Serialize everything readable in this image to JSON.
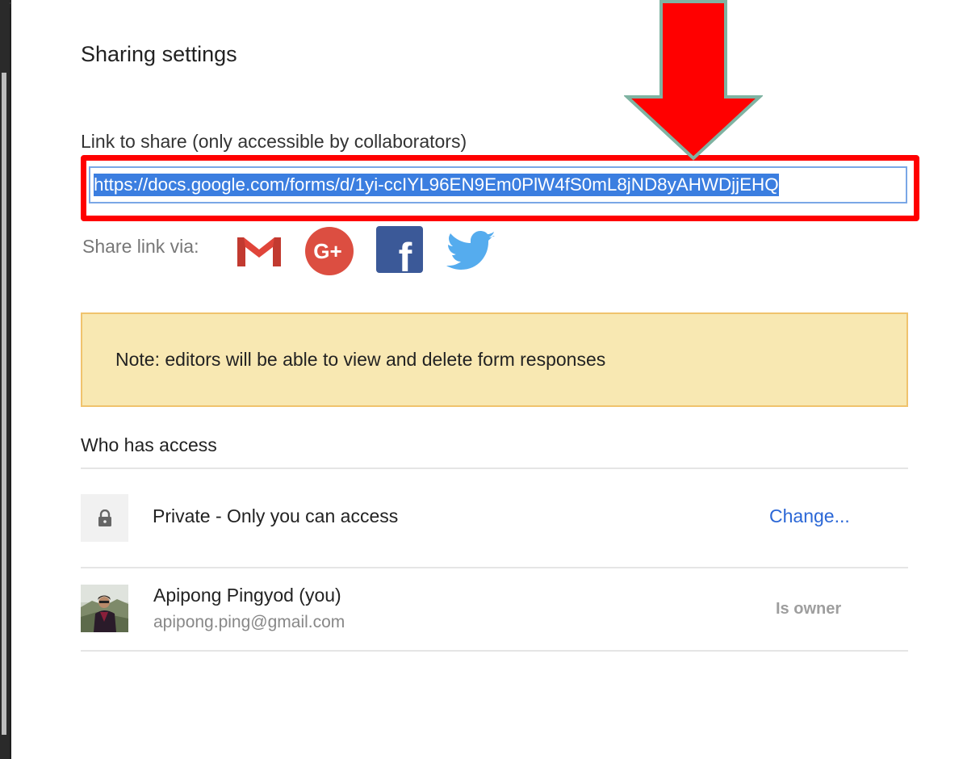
{
  "dialog": {
    "title": "Sharing settings"
  },
  "link": {
    "label": "Link to share (only accessible by collaborators)",
    "url": "https://docs.google.com/forms/d/1yi-ccIYL96EN9Em0PlW4fS0mL8jND8yAHWDjjEHQ"
  },
  "share_via": {
    "label": "Share link via:",
    "services": [
      {
        "name": "Gmail",
        "icon": "gmail-icon",
        "color": "#d93025"
      },
      {
        "name": "Google+",
        "icon": "google-plus-icon",
        "color": "#dd4b39",
        "glyph": "G+"
      },
      {
        "name": "Facebook",
        "icon": "facebook-icon",
        "color": "#3b5998",
        "glyph": "f"
      },
      {
        "name": "Twitter",
        "icon": "twitter-icon",
        "color": "#55acee"
      }
    ]
  },
  "note": {
    "text": "Note: editors will be able to view and delete form responses"
  },
  "access": {
    "heading": "Who has access",
    "visibility_text": "Private - Only you can access",
    "change_label": "Change...",
    "owner": {
      "name": "Apipong Pingyod (you)",
      "email": "apipong.ping@gmail.com",
      "role": "Is owner"
    }
  },
  "colors": {
    "highlight": "#ff0000",
    "note_bg": "#f8e8b2",
    "link_blue": "#2b67d6",
    "selection": "#3b7ee0"
  }
}
